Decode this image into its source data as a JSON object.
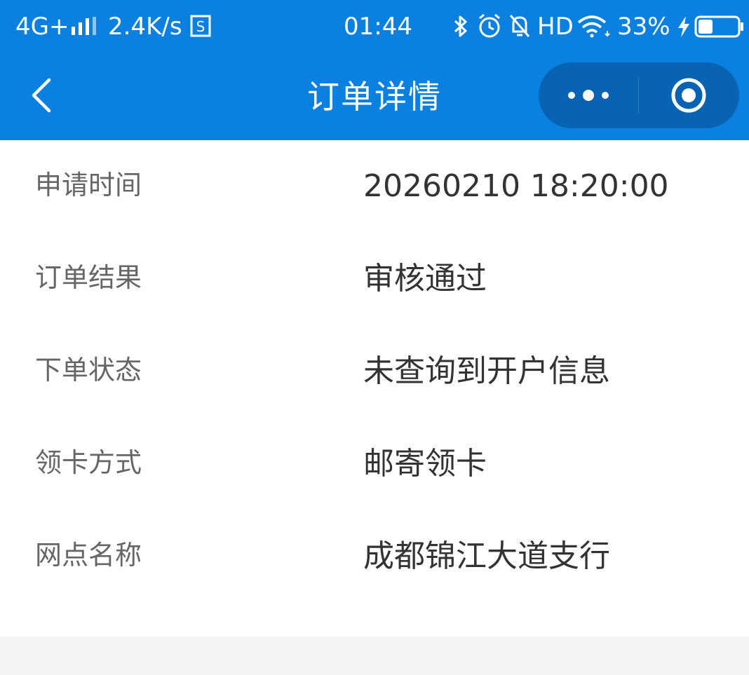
{
  "status_bar": {
    "network": "4G+",
    "speed": "2.4K/s",
    "time": "01:44",
    "hd": "HD",
    "battery": "33%",
    "icons": [
      "signal-icon",
      "screenshot-icon",
      "bluetooth-icon",
      "alarm-icon",
      "mute-bell-icon",
      "wifi-icon",
      "charging-icon",
      "battery-icon"
    ]
  },
  "nav": {
    "title": "订单详情",
    "back_icon": "chevron-left-icon",
    "more_icon": "more-dots-icon",
    "close_icon": "target-circle-icon"
  },
  "details": [
    {
      "label": "申请时间",
      "value": "20260210 18:20:00"
    },
    {
      "label": "订单结果",
      "value": "审核通过"
    },
    {
      "label": "下单状态",
      "value": "未查询到开户信息"
    },
    {
      "label": "领卡方式",
      "value": "邮寄领卡"
    },
    {
      "label": "网点名称",
      "value": "成都锦江大道支行"
    }
  ],
  "colors": {
    "primary": "#0a80e0",
    "capsule": "#0864b3",
    "label": "#666666",
    "value": "#333333",
    "background": "#f4f4f4"
  }
}
